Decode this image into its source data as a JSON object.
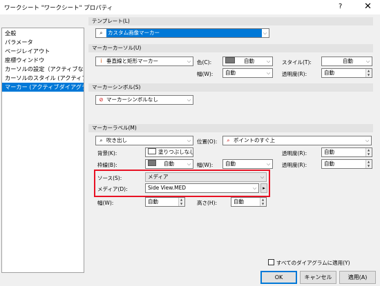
{
  "window": {
    "title": "ワークシート \"ワークシート\" プロパティ",
    "help": "?",
    "close": "✕"
  },
  "nav": {
    "items": [
      {
        "label": "全般",
        "selected": false
      },
      {
        "label": "パラメータ",
        "selected": false
      },
      {
        "label": "ページレイアウト",
        "selected": false
      },
      {
        "label": "座標ウィンドウ",
        "selected": false
      },
      {
        "label": "カーソルの設定（アクティブなダイ...",
        "selected": false
      },
      {
        "label": "カーソルのスタイル (アクティブなダイ...",
        "selected": false
      },
      {
        "label": "マーカー (アクティブダイアグラム)",
        "selected": true
      }
    ]
  },
  "template": {
    "header": "テンプレート(L)",
    "value": "カスタム画像マーカー"
  },
  "cursor": {
    "header": "マーカーカーソル(U)",
    "type_value": "垂直線と矩形マーカー",
    "color_label": "色(C):",
    "color_value": "自動",
    "style_label": "スタイル(T):",
    "style_value": "自動",
    "width_label": "幅(W):",
    "width_value": "自動",
    "transparency_label": "透明度(R):",
    "transparency_value": "自動"
  },
  "symbol": {
    "header": "マーカーシンボル(S)",
    "value": "マーカーシンボルなし"
  },
  "label": {
    "header": "マーカーラベル(M)",
    "type_value": "吹き出し",
    "position_label": "位置(O):",
    "position_value": "ポイントのすぐ上",
    "background_label": "背景(K):",
    "background_value": "塗りつぶしなし",
    "transparency_label": "透明度(R):",
    "transparency_value": "自動",
    "border_label": "枠線(B):",
    "border_value": "自動",
    "border_width_label": "幅(W):",
    "border_width_value": "自動",
    "border_transparency_label": "透明度(R):",
    "border_transparency_value": "自動",
    "source_label": "ソース(S):",
    "source_value": "メディア",
    "media_label": "メディア(D):",
    "media_value": "Side View.MED",
    "media_button": "▸",
    "img_width_label": "幅(W):",
    "img_width_value": "自動",
    "img_height_label": "高さ(H):",
    "img_height_value": "自動"
  },
  "footer": {
    "apply_all_label": "すべてのダイアグラムに適用(Y)",
    "ok": "OK",
    "cancel": "キャンセル",
    "apply": "適用(A)"
  },
  "colors": {
    "selection": "#0078d7",
    "highlight_box": "#e81123"
  }
}
